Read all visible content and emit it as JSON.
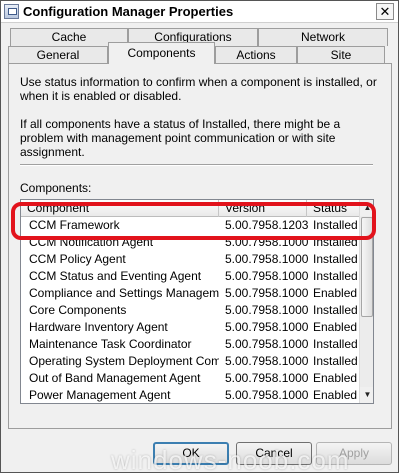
{
  "window": {
    "title": "Configuration Manager Properties",
    "close_label": "✕"
  },
  "tabs_back": [
    "Cache",
    "Configurations",
    "Network"
  ],
  "tabs_front": [
    "General",
    "Components",
    "Actions",
    "Site"
  ],
  "active_tab": "Components",
  "content": {
    "intro1": "Use status information to confirm when a component is installed, or when it is enabled or disabled.",
    "intro2": "If all components have a status of Installed, there might be a problem with management point communication or with site assignment.",
    "components_label": "Components:"
  },
  "listview": {
    "columns": [
      "Component",
      "Version",
      "Status"
    ],
    "rows": [
      {
        "name": "CCM Framework",
        "version": "5.00.7958.1203",
        "status": "Installed"
      },
      {
        "name": "CCM Notification Agent",
        "version": "5.00.7958.1000",
        "status": "Installed"
      },
      {
        "name": "CCM Policy Agent",
        "version": "5.00.7958.1000",
        "status": "Installed"
      },
      {
        "name": "CCM Status and Eventing Agent",
        "version": "5.00.7958.1000",
        "status": "Installed"
      },
      {
        "name": "Compliance and Settings Management",
        "version": "5.00.7958.1000",
        "status": "Enabled"
      },
      {
        "name": "Core Components",
        "version": "5.00.7958.1000",
        "status": "Installed"
      },
      {
        "name": "Hardware Inventory Agent",
        "version": "5.00.7958.1000",
        "status": "Enabled"
      },
      {
        "name": "Maintenance Task Coordinator",
        "version": "5.00.7958.1000",
        "status": "Installed"
      },
      {
        "name": "Operating System Deployment Compo...",
        "version": "5.00.7958.1000",
        "status": "Installed"
      },
      {
        "name": "Out of Band Management Agent",
        "version": "5.00.7958.1000",
        "status": "Enabled"
      },
      {
        "name": "Power Management Agent",
        "version": "5.00.7958.1000",
        "status": "Enabled"
      }
    ]
  },
  "buttons": {
    "ok": "OK",
    "cancel": "Cancel",
    "apply": "Apply"
  },
  "watermark": "windows-noob.com",
  "colors": {
    "highlight": "#e2131c",
    "default_button_border": "#3c7fb1"
  }
}
